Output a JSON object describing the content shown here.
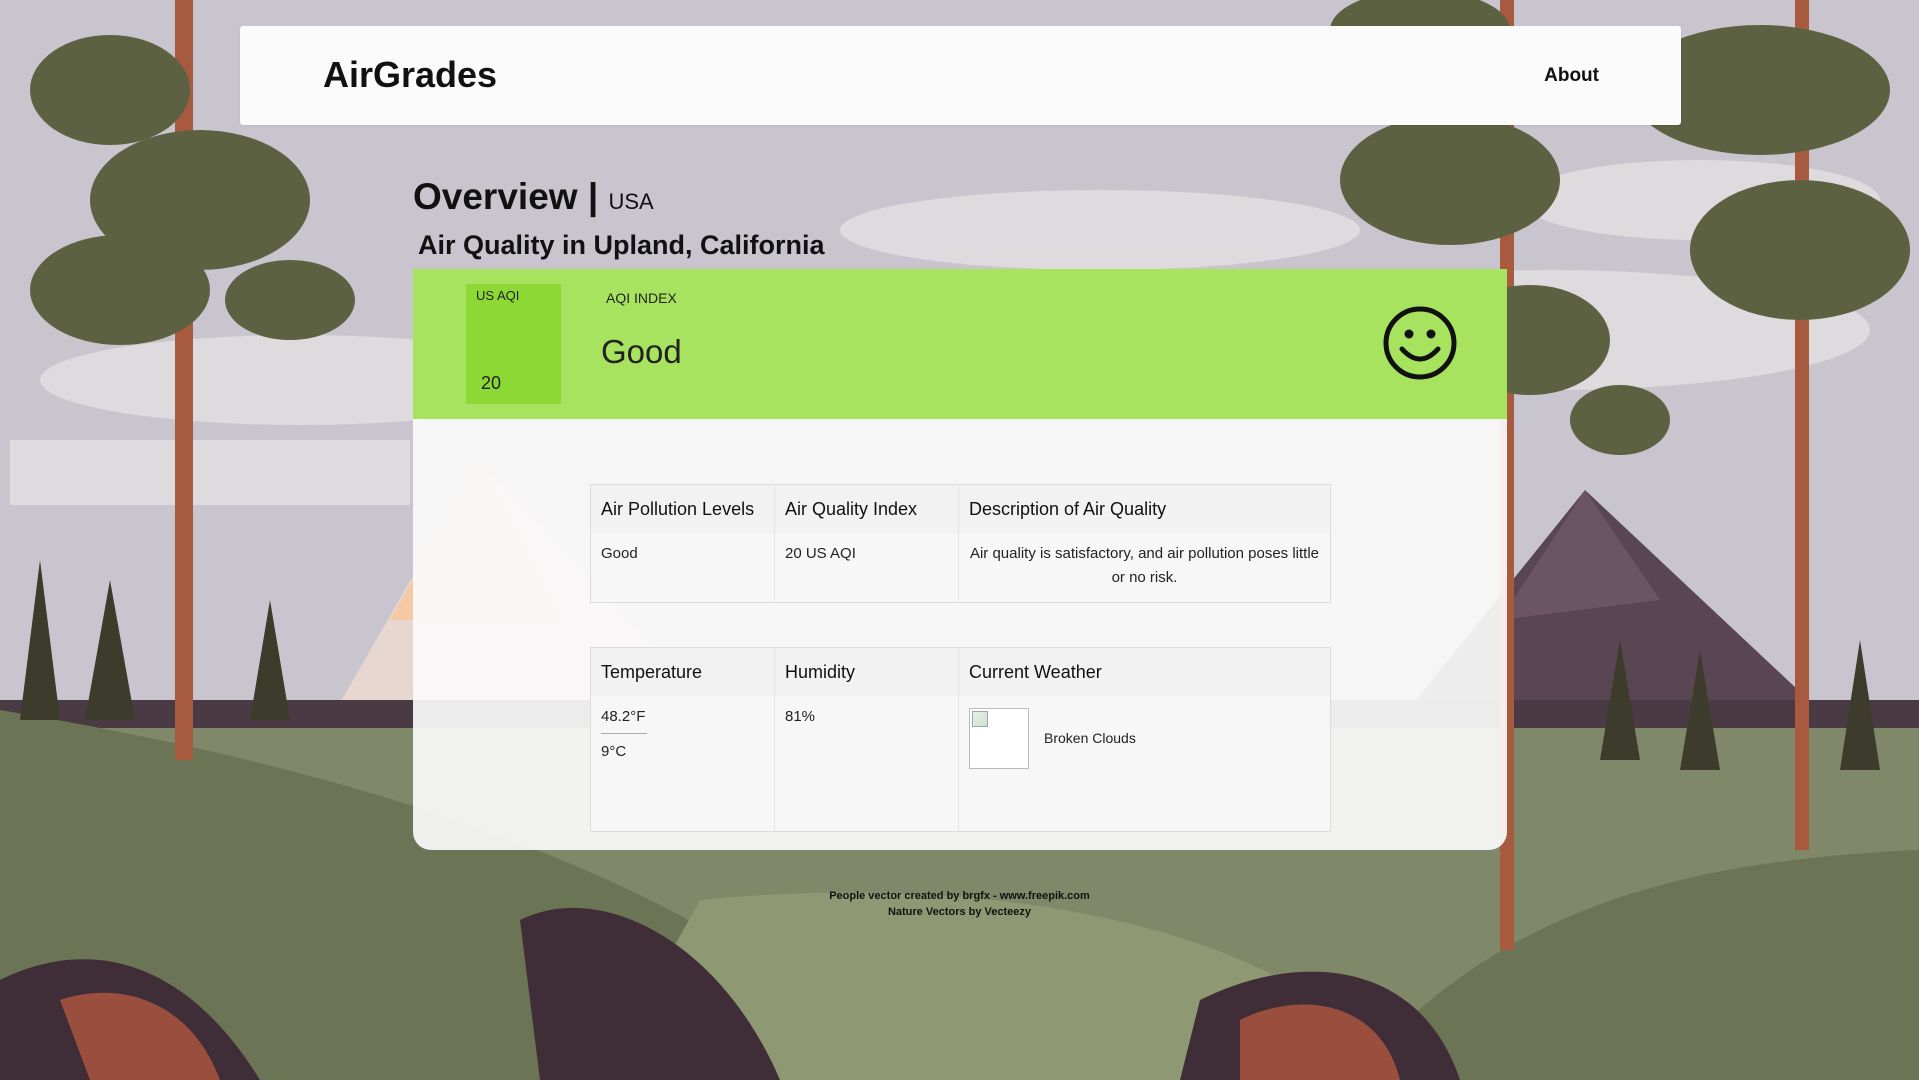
{
  "header": {
    "brand": "AirGrades",
    "about_label": "About"
  },
  "overview": {
    "title": "Overview |",
    "country": "USA"
  },
  "city_title": "Air Quality in Upland, California",
  "aqi": {
    "box_label": "US AQI",
    "value": "20",
    "index_label": "AQI INDEX",
    "status": "Good",
    "icon": "smiley-face-icon",
    "banner_color": "#a8e360",
    "box_color": "#8cd835"
  },
  "pollution_table": {
    "headers": [
      "Air Pollution Levels",
      "Air Quality Index",
      "Description of Air Quality"
    ],
    "row": [
      "Good",
      "20 US AQI",
      "Air quality is satisfactory, and air pollution poses little or no risk."
    ]
  },
  "weather_table": {
    "headers": [
      "Temperature",
      "Humidity",
      "Current Weather"
    ],
    "temp_f": "48.2°F",
    "temp_c": "9°C",
    "humidity": "81%",
    "weather_icon": "broken-image-icon",
    "weather_desc": "Broken Clouds"
  },
  "credits": {
    "line1": "People vector created by brgfx - www.freepik.com",
    "line2": "Nature Vectors by Vecteezy"
  }
}
